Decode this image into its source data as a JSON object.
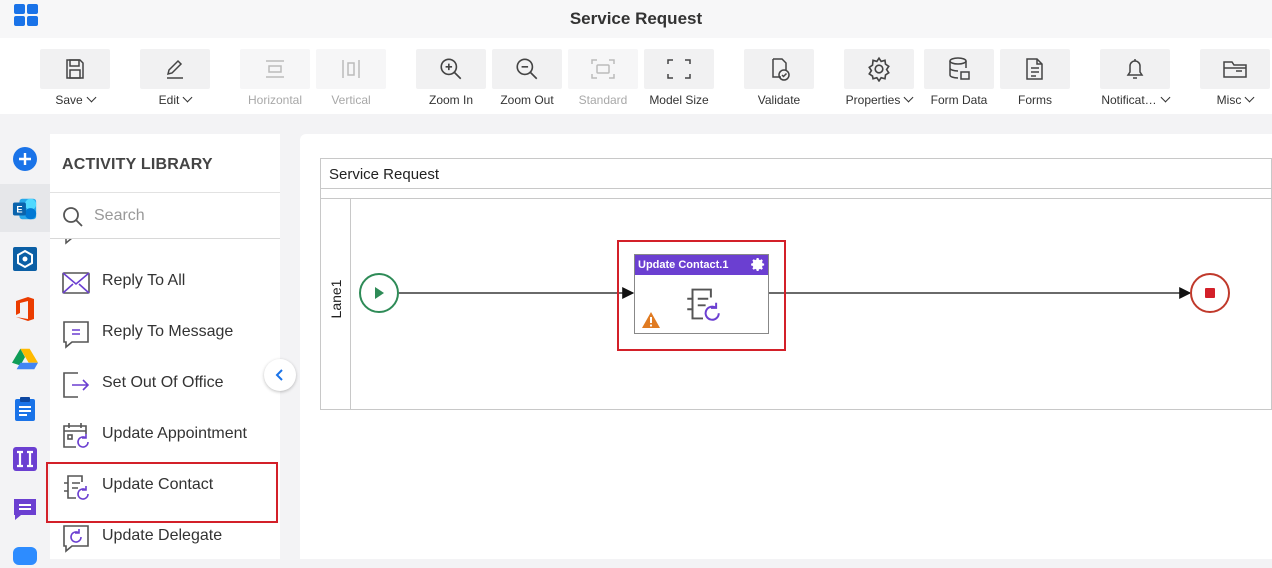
{
  "window": {
    "title": "Service Request"
  },
  "toolbar": {
    "items": [
      {
        "label": "Save",
        "icon": "save-icon",
        "dropdown": true,
        "disabled": false
      },
      {
        "label": "Edit",
        "icon": "edit-icon",
        "dropdown": true,
        "disabled": false
      },
      {
        "label": "Horizontal",
        "icon": "horizontal-icon",
        "dropdown": false,
        "disabled": true
      },
      {
        "label": "Vertical",
        "icon": "vertical-icon",
        "dropdown": false,
        "disabled": true
      },
      {
        "label": "Zoom In",
        "icon": "zoom-in-icon",
        "dropdown": false,
        "disabled": false
      },
      {
        "label": "Zoom Out",
        "icon": "zoom-out-icon",
        "dropdown": false,
        "disabled": false
      },
      {
        "label": "Standard",
        "icon": "standard-icon",
        "dropdown": false,
        "disabled": true
      },
      {
        "label": "Model Size",
        "icon": "model-size-icon",
        "dropdown": false,
        "disabled": false
      },
      {
        "label": "Validate",
        "icon": "validate-icon",
        "dropdown": false,
        "disabled": false
      },
      {
        "label": "Properties",
        "icon": "gear-icon",
        "dropdown": true,
        "disabled": false
      },
      {
        "label": "Form Data",
        "icon": "database-icon",
        "dropdown": false,
        "disabled": false
      },
      {
        "label": "Forms",
        "icon": "forms-icon",
        "dropdown": false,
        "disabled": false
      },
      {
        "label": "Notificat…",
        "icon": "bell-icon",
        "dropdown": true,
        "disabled": false
      },
      {
        "label": "Misc",
        "icon": "folder-icon",
        "dropdown": true,
        "disabled": false
      }
    ]
  },
  "rail": {
    "icons": [
      "add-icon",
      "exchange-icon",
      "box-icon",
      "office-icon",
      "google-drive-icon",
      "clipboard-icon",
      "integration-icon",
      "chat-icon",
      "video-icon"
    ],
    "active": "exchange-icon"
  },
  "library": {
    "title": "ACTIVITY LIBRARY",
    "search_placeholder": "Search",
    "items": [
      {
        "label": "Reply To All",
        "icon": "mail-icon"
      },
      {
        "label": "Reply To Message",
        "icon": "message-icon"
      },
      {
        "label": "Set Out Of Office",
        "icon": "exit-icon"
      },
      {
        "label": "Update Appointment",
        "icon": "calendar-refresh-icon"
      },
      {
        "label": "Update Contact",
        "icon": "contact-refresh-icon",
        "selected": true
      },
      {
        "label": "Update Delegate",
        "icon": "delegate-refresh-icon"
      }
    ]
  },
  "canvas": {
    "pool_title": "Service Request",
    "lane_label": "Lane1",
    "task": {
      "title": "Update Contact.1",
      "warning": true,
      "selected": true
    },
    "colors": {
      "accent": "#6b3fd1",
      "start": "#2e8b57",
      "end": "#c0392b",
      "highlight": "#d32029",
      "warning": "#e67e22"
    }
  }
}
